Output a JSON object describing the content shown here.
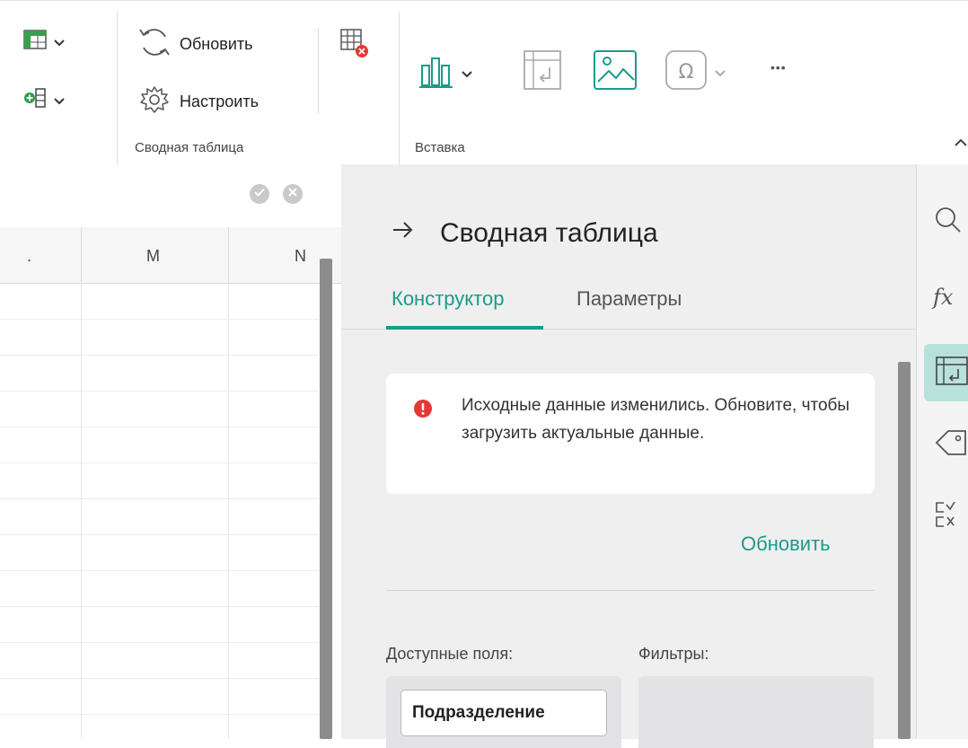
{
  "ribbon": {
    "refresh_label": "Обновить",
    "configure_label": "Настроить",
    "pivot_group_label": "Сводная таблица",
    "insert_group_label": "Вставка",
    "more_label": "•••"
  },
  "sheet": {
    "columns": [
      "M",
      "N"
    ],
    "partial_column_mark": "."
  },
  "panel": {
    "title": "Сводная таблица",
    "tabs": [
      "Конструктор",
      "Параметры"
    ],
    "active_tab": "Конструктор",
    "alert_text": "Исходные данные изменились. Обновите, чтобы загрузить актуальные данные.",
    "refresh_link": "Обновить",
    "available_fields_label": "Доступные поля:",
    "filters_label": "Фильтры:",
    "fields": [
      "Подразделение"
    ]
  },
  "sidebar": {
    "fx_label": "fx"
  },
  "colors": {
    "accent": "#1a9b8a",
    "alert_red": "#e53935",
    "panel_bg": "#efeff0"
  }
}
